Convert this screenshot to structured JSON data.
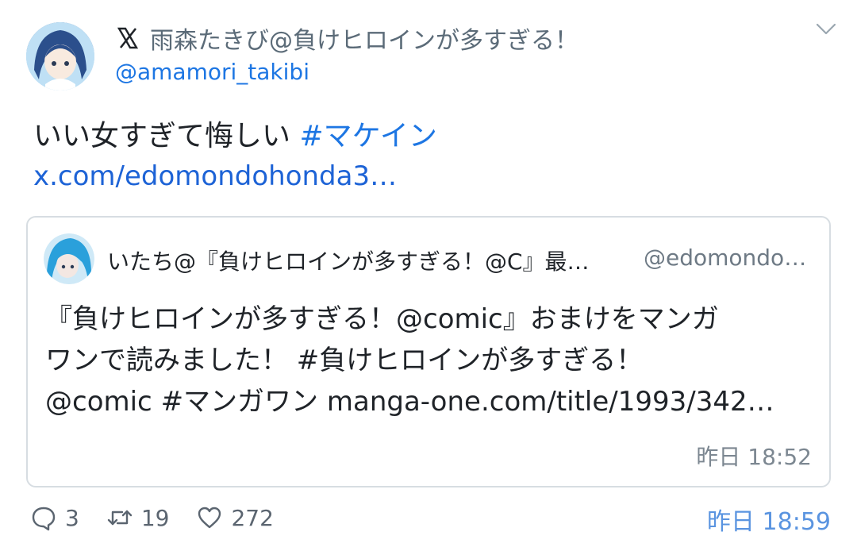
{
  "author": {
    "display_name": "雨森たきび@負けヒロインが多すぎる！",
    "handle": "@amamori_takibi",
    "avatar_icon": "anime-girl-avatar",
    "platform_icon": "x-logo-icon"
  },
  "tweet": {
    "text": "いい女すぎて悔しい ",
    "hashtag": "#マケイン",
    "link": "x.com/edomondohonda3…",
    "time": "昨日 18:59"
  },
  "quote": {
    "display_name": "いたち@『負けヒロインが多すぎる！@C』最…",
    "handle": "@edomondo…",
    "lines": [
      "『負けヒロインが多すぎる！@comic』おまけをマンガ",
      "ワンで読みました！ #負けヒロインが多すぎる！",
      "@comic #マンガワン manga-one.com/title/1993/342…"
    ],
    "time": "昨日 18:52"
  },
  "actions": {
    "replies": "3",
    "retweets": "19",
    "likes": "272"
  },
  "colors": {
    "link": "#1d76e3",
    "muted": "#6e7a85",
    "border": "#d7dde2"
  }
}
